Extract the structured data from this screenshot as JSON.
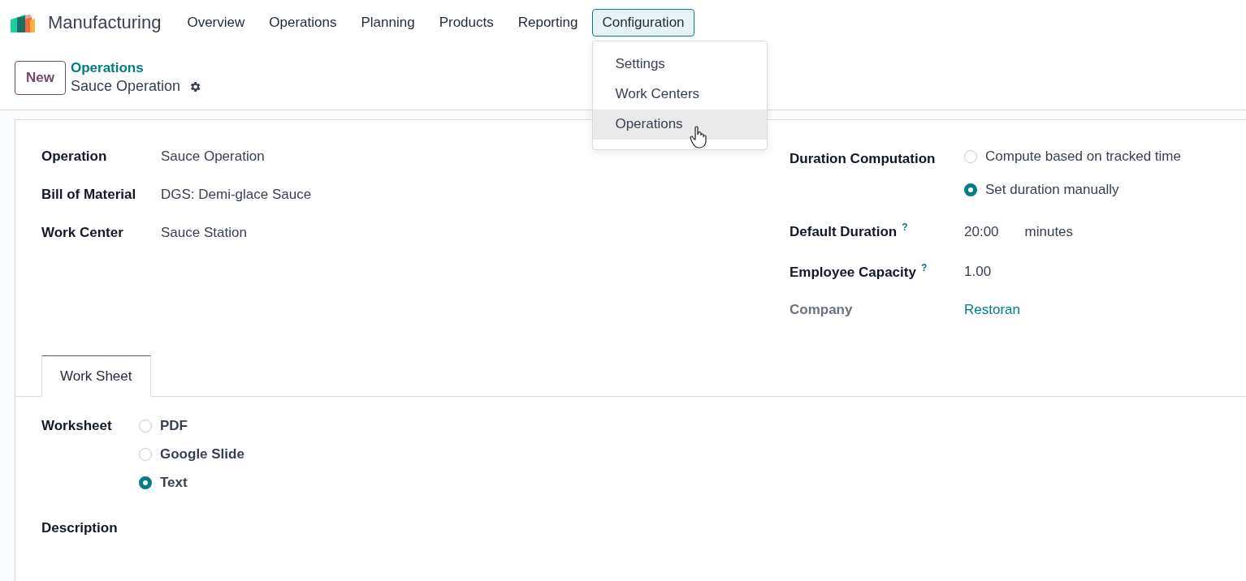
{
  "app": {
    "name": "Manufacturing"
  },
  "nav": [
    {
      "label": "Overview",
      "selected": false
    },
    {
      "label": "Operations",
      "selected": false
    },
    {
      "label": "Planning",
      "selected": false
    },
    {
      "label": "Products",
      "selected": false
    },
    {
      "label": "Reporting",
      "selected": false
    },
    {
      "label": "Configuration",
      "selected": true
    }
  ],
  "menu": [
    {
      "label": "Settings",
      "selected": false
    },
    {
      "label": "Work Centers",
      "selected": false
    },
    {
      "label": "Operations",
      "selected": true
    }
  ],
  "control_panel": {
    "new_button": "New",
    "breadcrumb": "Operations",
    "record": "Sauce Operation"
  },
  "left_fields": [
    {
      "label": "Operation",
      "value": "Sauce Operation"
    },
    {
      "label": "Bill of Material",
      "value": "DGS: Demi-glace Sauce"
    },
    {
      "label": "Work Center",
      "value": "Sauce Station"
    }
  ],
  "duration_computation": {
    "label": "Duration Computation",
    "options": [
      {
        "label": "Compute based on tracked time",
        "selected": false
      },
      {
        "label": "Set duration manually",
        "selected": true
      }
    ]
  },
  "right_fields": [
    {
      "label": "Default Duration",
      "help": "?",
      "value": "20:00",
      "unit": "minutes",
      "kind": "plain"
    },
    {
      "label": "Employee Capacity",
      "help": "?",
      "value": "1.00",
      "kind": "plain"
    },
    {
      "label": "Company",
      "value": "Restoran",
      "kind": "link"
    }
  ],
  "tabs": [
    {
      "label": "Work Sheet",
      "selected": true
    }
  ],
  "worksheet": {
    "label": "Worksheet",
    "options": [
      {
        "label": "PDF",
        "selected": false
      },
      {
        "label": "Google Slide",
        "selected": false
      },
      {
        "label": "Text",
        "selected": true
      }
    ]
  },
  "description": {
    "label": "Description"
  }
}
